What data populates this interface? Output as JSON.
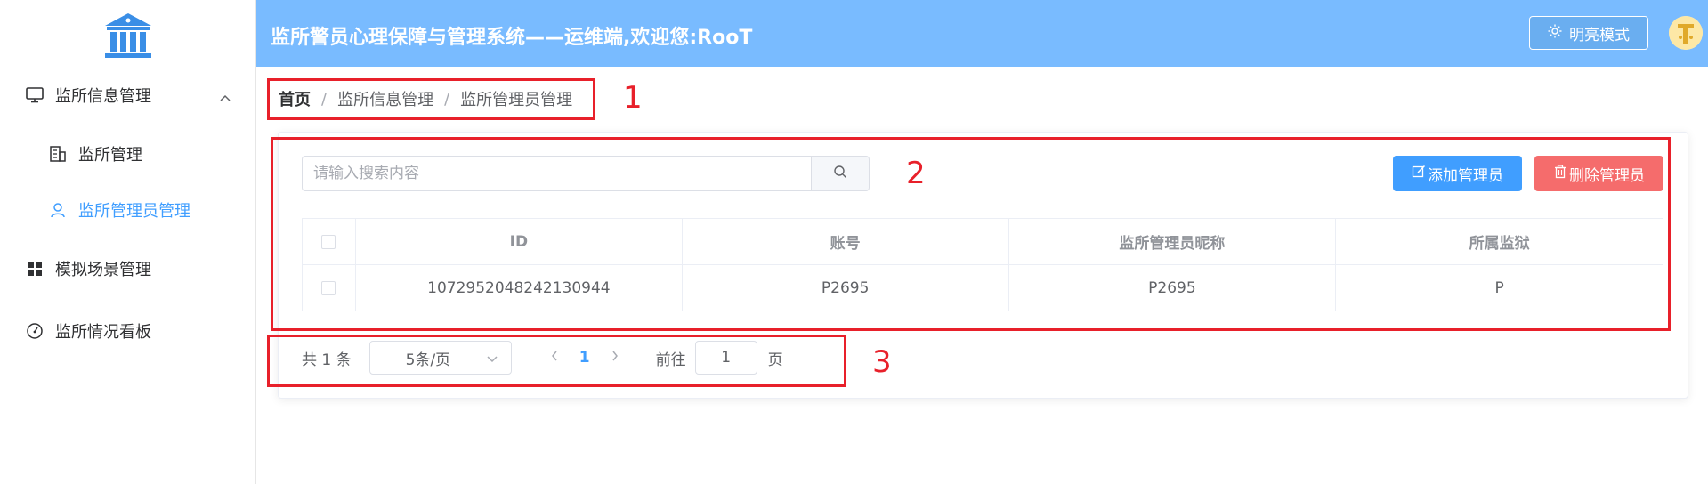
{
  "header": {
    "title": "监所警员心理保障与管理系统——运维端,欢迎您:RooT",
    "mode_button": "明亮模式"
  },
  "sidebar": {
    "items": [
      {
        "label": "监所信息管理",
        "icon": "monitor-icon",
        "expanded": true
      },
      {
        "label": "监所管理",
        "icon": "building-icon"
      },
      {
        "label": "监所管理员管理",
        "icon": "user-icon",
        "active": true
      },
      {
        "label": "模拟场景管理",
        "icon": "grid-icon"
      },
      {
        "label": "监所情况看板",
        "icon": "gauge-icon"
      }
    ]
  },
  "breadcrumb": {
    "home": "首页",
    "sep": "/",
    "level1": "监所信息管理",
    "level2": "监所管理员管理"
  },
  "search": {
    "placeholder": "请输入搜索内容",
    "value": ""
  },
  "actions": {
    "add": "添加管理员",
    "delete": "删除管理员"
  },
  "table": {
    "columns": [
      "ID",
      "账号",
      "监所管理员昵称",
      "所属监狱"
    ],
    "rows": [
      [
        "1072952048242130944",
        "P2695",
        "P2695",
        "P"
      ]
    ]
  },
  "pagination": {
    "total": "共 1 条",
    "page_size": "5条/页",
    "current_page": "1",
    "goto_label": "前往",
    "goto_value": "1",
    "page_unit": "页"
  },
  "annotations": [
    "1",
    "2",
    "3"
  ],
  "colors": {
    "header_bg": "#79bbff",
    "primary": "#409eff",
    "danger": "#f56c6c",
    "annotation": "#e8202a"
  }
}
